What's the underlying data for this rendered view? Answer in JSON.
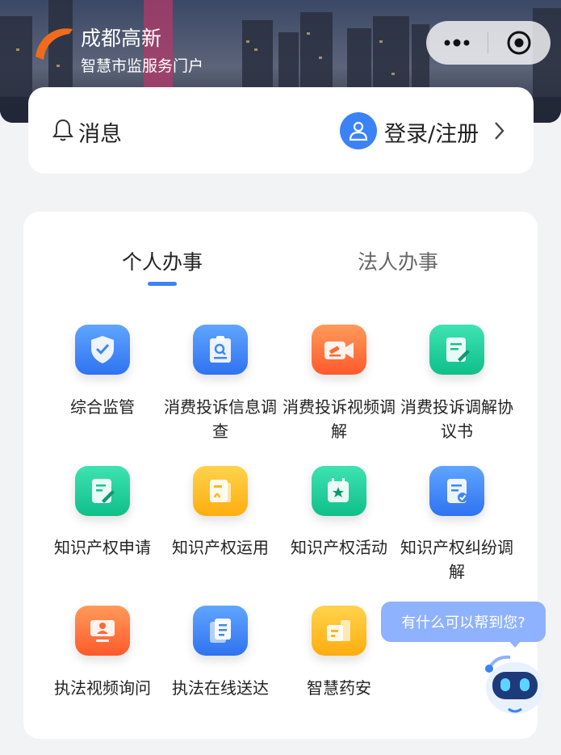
{
  "header": {
    "brand_name": "成都高新",
    "brand_sub": "智慧市监服务门户",
    "capsule": {
      "more_icon": "more-dots-icon",
      "close_icon": "target-close-icon"
    }
  },
  "message_bar": {
    "message_label": "消息",
    "login_label": "登录/注册"
  },
  "tabs": [
    {
      "label": "个人办事",
      "active": true
    },
    {
      "label": "法人办事",
      "active": false
    }
  ],
  "services": [
    {
      "label": "综合监管",
      "icon": "shield-check-icon",
      "color": "blue"
    },
    {
      "label": "消费投诉信息调查",
      "icon": "clipboard-search-icon",
      "color": "blue"
    },
    {
      "label": "消费投诉视频调解",
      "icon": "video-gavel-icon",
      "color": "orange"
    },
    {
      "label": "消费投诉调解协议书",
      "icon": "document-sign-icon",
      "color": "green"
    },
    {
      "label": "知识产权申请",
      "icon": "edit-form-icon",
      "color": "green"
    },
    {
      "label": "知识产权运用",
      "icon": "patent-doc-icon",
      "color": "yellow"
    },
    {
      "label": "知识产权活动",
      "icon": "calendar-star-icon",
      "color": "green"
    },
    {
      "label": "知识产权纠纷调解",
      "icon": "doc-check-icon",
      "color": "blue"
    },
    {
      "label": "执法视频询问",
      "icon": "monitor-person-icon",
      "color": "orange"
    },
    {
      "label": "执法在线送达",
      "icon": "files-icon",
      "color": "blue"
    },
    {
      "label": "智慧药安",
      "icon": "medicine-icon",
      "color": "yellow"
    }
  ],
  "assistant": {
    "bubble_text": "有什么可以帮到您?",
    "icon": "robot-assistant-icon"
  },
  "colors": {
    "accent": "#3b82f6",
    "bubble": "#8fb2ff"
  }
}
